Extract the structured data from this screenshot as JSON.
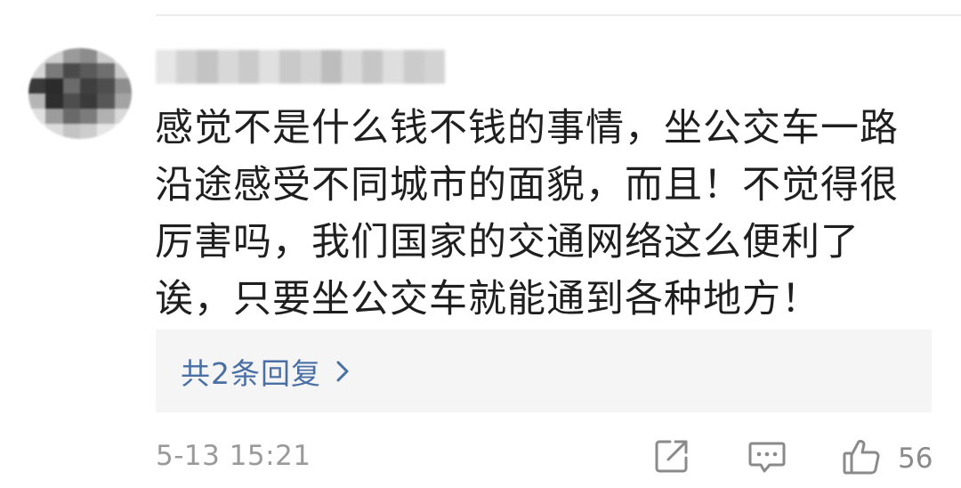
{
  "comment": {
    "text": "感觉不是什么钱不钱的事情，坐公交车一路沿途感受不同城市的面貌，而且！不觉得很厉害吗，我们国家的交通网络这么便利了诶，只要坐公交车就能通到各种地方！",
    "replies_label": "共2条回复",
    "timestamp": "5-13 15:21",
    "like_count": "56"
  },
  "icons": {
    "avatar": "blurred-avatar",
    "username": "blurred-username",
    "replies_arrow": "chevron-right-icon",
    "share": "share-icon",
    "reply": "comment-icon",
    "like": "thumbs-up-icon"
  },
  "colors": {
    "text": "#1f1f1f",
    "link": "#4a6fa5",
    "muted": "#9a9a9a",
    "icon": "#8a8a8a",
    "reply_bg": "#f5f5f5"
  }
}
